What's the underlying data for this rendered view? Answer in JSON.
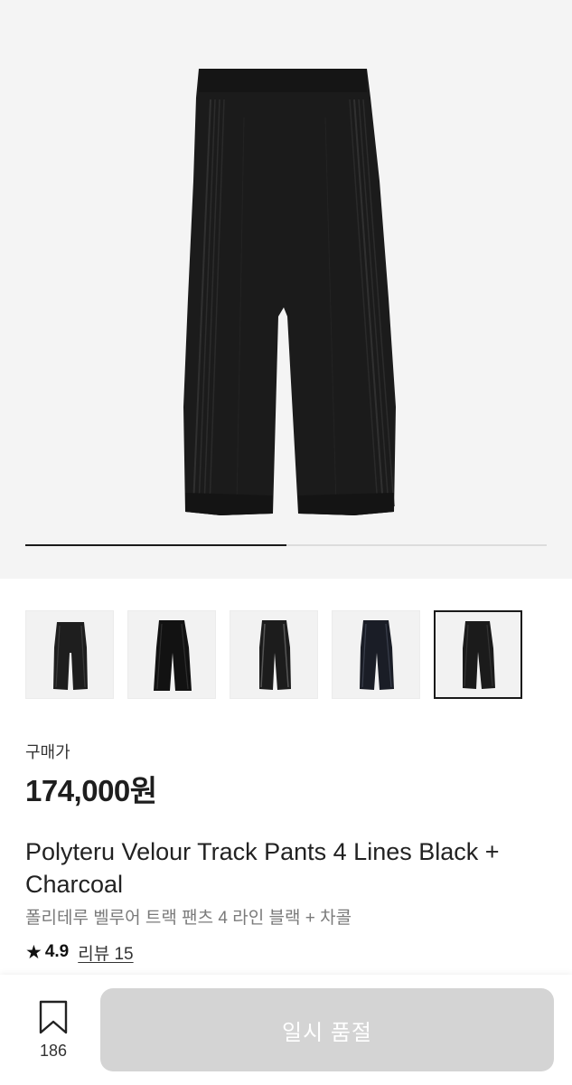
{
  "product": {
    "image_alt": "Black velour track pants",
    "image_progress": 0.5,
    "thumbnails": [
      {
        "name": "thumb-1",
        "selected": false
      },
      {
        "name": "thumb-2",
        "selected": false
      },
      {
        "name": "thumb-3",
        "selected": false
      },
      {
        "name": "thumb-4",
        "selected": false
      },
      {
        "name": "thumb-5",
        "selected": true
      }
    ],
    "price_label": "구매가",
    "price": "174,000원",
    "title_en": "Polyteru Velour Track Pants 4 Lines Black + Charcoal",
    "title_ko": "폴리테루 벨루어 트랙 팬츠 4 라인 블랙 + 차콜",
    "rating": "4.9",
    "review_label": "리뷰 15",
    "star_icon": "star-icon"
  },
  "bottom_bar": {
    "wishlist_count": "186",
    "wishlist_icon": "bookmark-icon",
    "sold_out_label": "일시 품절"
  },
  "colors": {
    "hero_background": "#f4f4f4",
    "button_disabled": "#d4d4d4",
    "text_primary": "#222222",
    "text_secondary": "#7a7a7a"
  }
}
